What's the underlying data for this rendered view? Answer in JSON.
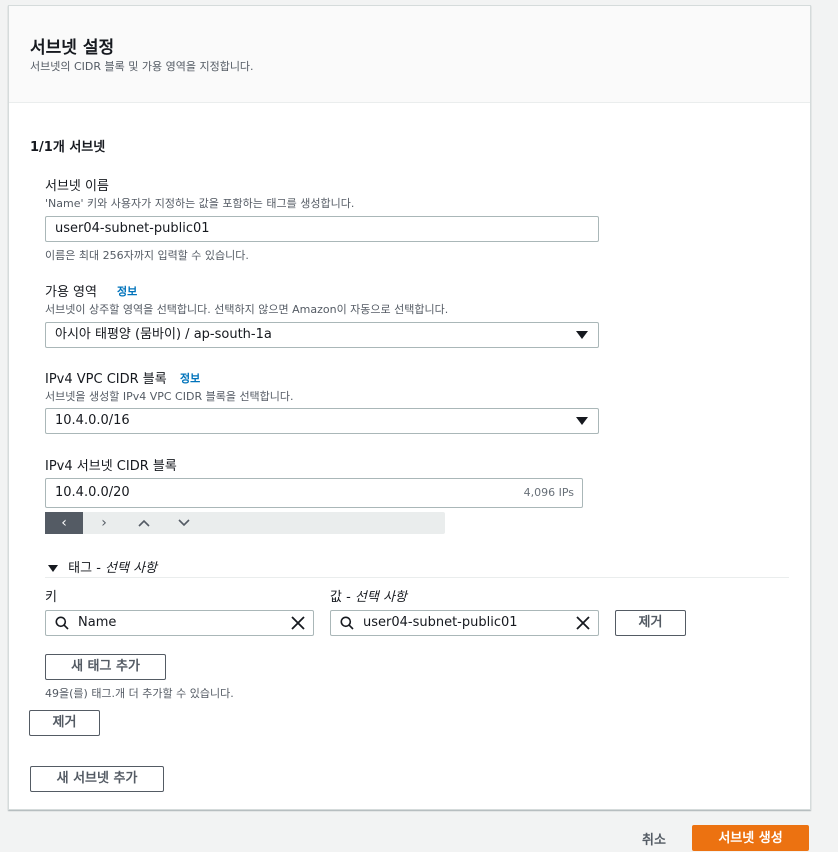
{
  "section": {
    "title": "서브넷 설정",
    "description": "서브넷의 CIDR 블록 및 가용 영역을 지정합니다."
  },
  "subnet_block": {
    "heading": "1/1개 서브넷",
    "name_label": "서브넷 이름",
    "name_desc": "'Name' 키와 사용자가 지정하는 값을 포함하는 태그를 생성합니다.",
    "name_value": "user04-subnet-public01",
    "name_hint": "이름은 최대 256자까지 입력할 수 있습니다.",
    "az_label": "가용 영역",
    "az_info": "정보",
    "az_desc": "서브넷이 상주할 영역을 선택합니다. 선택하지 않으면 Amazon이 자동으로 선택합니다.",
    "az_value": "아시아 태평양 (뭄바이) / ap-south-1a",
    "vpc_cidr_label": "IPv4 VPC CIDR 블록",
    "vpc_cidr_info": "정보",
    "vpc_cidr_desc": "서브넷을 생성할 IPv4 VPC CIDR 블록을 선택합니다.",
    "vpc_cidr_value": "10.4.0.0/16",
    "subnet_cidr_label": "IPv4 서브넷 CIDR 블록",
    "subnet_cidr_value": "10.4.0.0/20",
    "subnet_cidr_count": "4,096 IPs",
    "pager_icons": [
      "chevron-left-icon",
      "chevron-right-icon",
      "chevron-up-icon",
      "chevron-down-icon"
    ]
  },
  "tags": {
    "toggle_label": "태그 - ",
    "toggle_label_italic": "선택 사항",
    "key_header": "키",
    "value_header": "값 - ",
    "value_header_italic": "선택 사항",
    "key_value": "Name",
    "value_value": "user04-subnet-public01",
    "remove_tag_label": "제거",
    "add_tag_label": "새 태그 추가",
    "limit_note": "49을(를) 태그.개 더 추가할 수 있습니다.",
    "remove_subnet_label": "제거",
    "add_subnet_label": "새 서브넷 추가"
  },
  "footer": {
    "cancel_label": "취소",
    "create_label": "서브넷 생성"
  },
  "colors": {
    "accent": "#ec7211",
    "link": "#0073bb",
    "border": "#aab7b8"
  }
}
